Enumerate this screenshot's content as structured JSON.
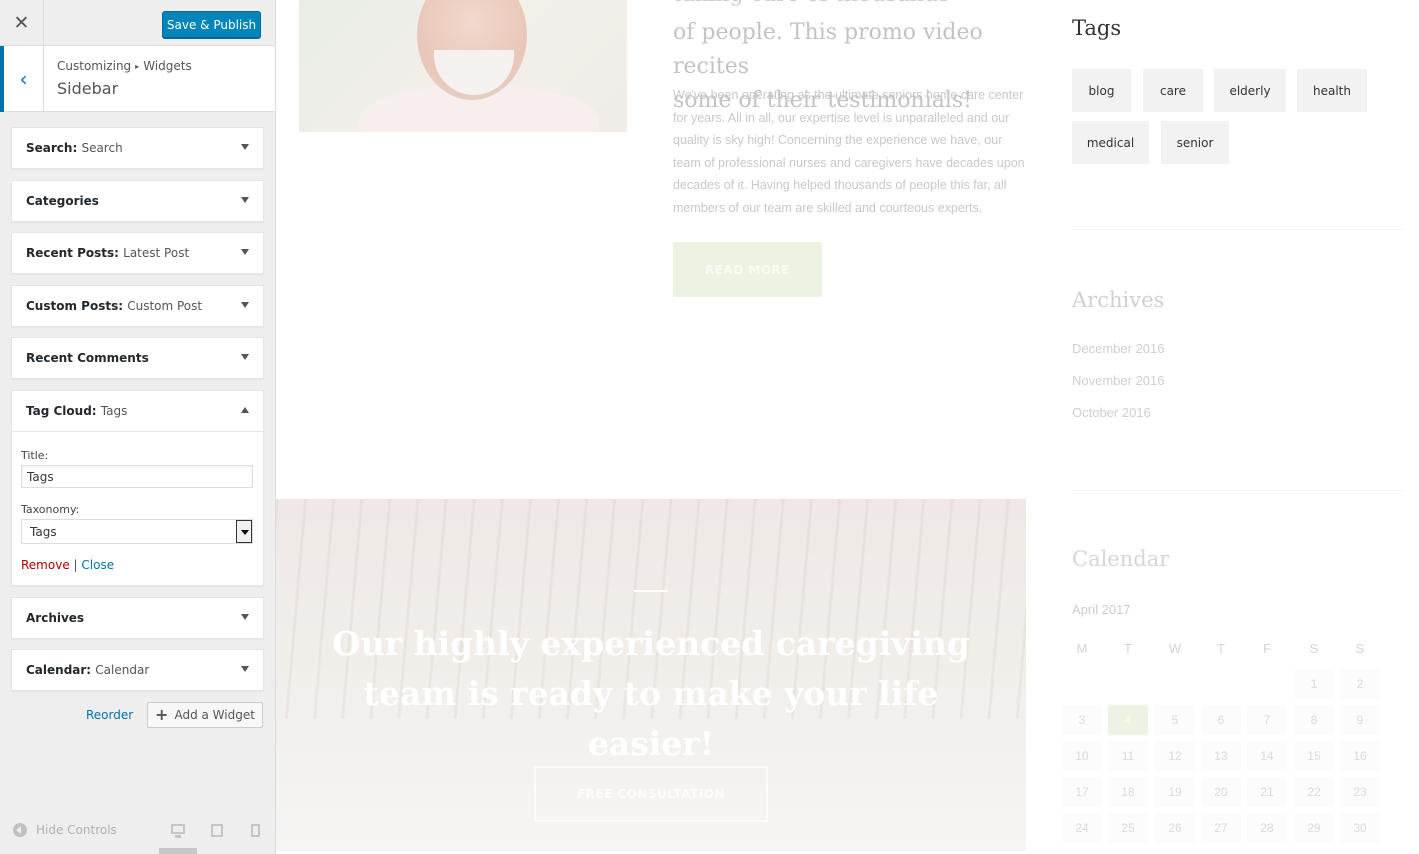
{
  "customizer": {
    "close_icon": "close-icon",
    "save_label": "Save & Publish",
    "breadcrumb": [
      "Customizing",
      "Widgets"
    ],
    "section_title": "Sidebar",
    "widgets": [
      {
        "name": "Search:",
        "sub": "Search"
      },
      {
        "name": "Categories",
        "sub": ""
      },
      {
        "name": "Recent Posts:",
        "sub": "Latest Post"
      },
      {
        "name": "Custom Posts:",
        "sub": "Custom Post"
      },
      {
        "name": "Recent Comments",
        "sub": ""
      },
      {
        "name": "Tag Cloud:",
        "sub": "Tags"
      },
      {
        "name": "Archives",
        "sub": ""
      },
      {
        "name": "Calendar:",
        "sub": "Calendar"
      }
    ],
    "tag_cloud_form": {
      "title_label": "Title:",
      "title_value": "Tags",
      "taxonomy_label": "Taxonomy:",
      "taxonomy_value": "Tags",
      "remove_label": "Remove",
      "separator": "|",
      "close_label": "Close"
    },
    "reorder_label": "Reorder",
    "add_widget_label": "Add a Widget",
    "hide_controls_label": "Hide Controls"
  },
  "preview": {
    "article": {
      "heading_top": "taking care of thousands",
      "heading_lines": [
        "of people. This promo video recites",
        "some of their testimonials!"
      ],
      "body": "We've been operating as the ultimate seniors home care center for years. All in all, our expertise level is unparalleled and our quality is sky high! Concerning the experience we have, our team of professional nurses and caregivers have decades upon decades of it. Having helped thousands of people this far, all members of our team are skilled and courteous experts.",
      "read_more": "READ MORE"
    },
    "banner": {
      "quote_line1": "Our highly experienced caregiving",
      "quote_line2": "team is ready to make your life easier!",
      "button": "FREE CONSULTATION"
    },
    "sidebar": {
      "tags_title": "Tags",
      "tags": [
        "blog",
        "care",
        "elderly",
        "health",
        "medical",
        "senior"
      ],
      "archives_title": "Archives",
      "archives": [
        "December 2016",
        "November 2016",
        "October 2016"
      ],
      "calendar_title": "Calendar",
      "calendar_month": "April 2017",
      "weekdays": [
        "M",
        "T",
        "W",
        "T",
        "F",
        "S",
        "S"
      ],
      "days": [
        "1",
        "2",
        "3",
        "4",
        "5",
        "6",
        "7",
        "8",
        "9",
        "10",
        "11",
        "12",
        "13",
        "14",
        "15",
        "16",
        "17",
        "18",
        "19",
        "20",
        "21",
        "22",
        "23",
        "24",
        "25",
        "26",
        "27",
        "28",
        "29",
        "30"
      ],
      "today": "4"
    }
  }
}
